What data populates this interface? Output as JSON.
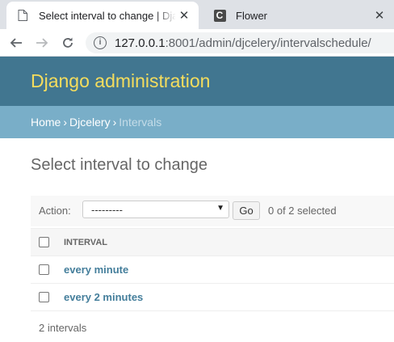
{
  "browser": {
    "tabs": [
      {
        "title": "Select interval to change | Django site admin",
        "active": true,
        "close": "✕"
      },
      {
        "title": "Flower",
        "active": false,
        "favicon_letter": "C",
        "close": "✕"
      }
    ],
    "url_host": "127.0.0.1",
    "url_rest": ":8001/admin/djcelery/intervalschedule/"
  },
  "admin": {
    "branding": "Django administration",
    "breadcrumbs": {
      "home": "Home",
      "sep": "›",
      "app": "Djcelery",
      "current": "Intervals"
    },
    "title": "Select interval to change",
    "actions": {
      "label": "Action:",
      "selected": "---------",
      "go": "Go",
      "count": "0 of 2 selected"
    },
    "table": {
      "columns": [
        "INTERVAL"
      ],
      "rows": [
        {
          "interval": "every minute"
        },
        {
          "interval": "every 2 minutes"
        }
      ]
    },
    "paginator": "2 intervals"
  },
  "colors": {
    "header": "#417690",
    "breadcrumbs": "#79aec8",
    "branding": "#f5dd5d",
    "link": "#447e9b"
  }
}
